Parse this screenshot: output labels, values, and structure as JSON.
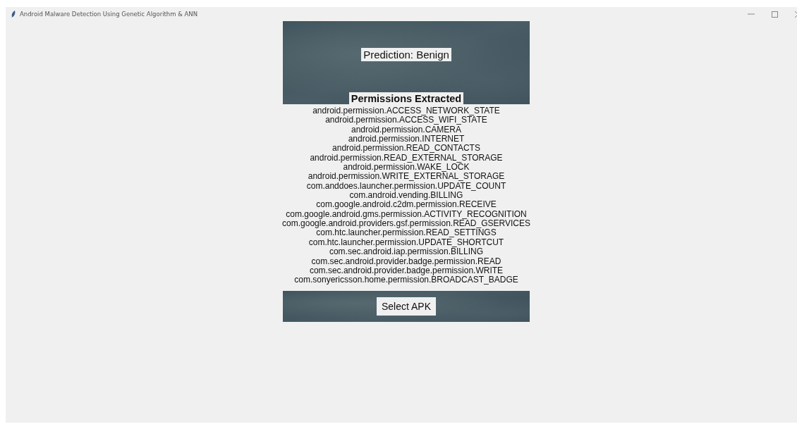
{
  "window": {
    "title": "Android Malware Detection Using Genetic Algorithm & ANN"
  },
  "prediction": "Prediction: Benign",
  "permissions_heading": "Permissions Extracted",
  "permissions": [
    "android.permission.ACCESS_NETWORK_STATE",
    "android.permission.ACCESS_WIFI_STATE",
    "android.permission.CAMERA",
    "android.permission.INTERNET",
    "android.permission.READ_CONTACTS",
    "android.permission.READ_EXTERNAL_STORAGE",
    "android.permission.WAKE_LOCK",
    "android.permission.WRITE_EXTERNAL_STORAGE",
    "com.anddoes.launcher.permission.UPDATE_COUNT",
    "com.android.vending.BILLING",
    "com.google.android.c2dm.permission.RECEIVE",
    "com.google.android.gms.permission.ACTIVITY_RECOGNITION",
    "com.google.android.providers.gsf.permission.READ_GSERVICES",
    "com.htc.launcher.permission.READ_SETTINGS",
    "com.htc.launcher.permission.UPDATE_SHORTCUT",
    "com.sec.android.iap.permission.BILLING",
    "com.sec.android.provider.badge.permission.READ",
    "com.sec.android.provider.badge.permission.WRITE",
    "com.sonyericsson.home.permission.BROADCAST_BADGE"
  ],
  "buttons": [
    "Select APK"
  ]
}
